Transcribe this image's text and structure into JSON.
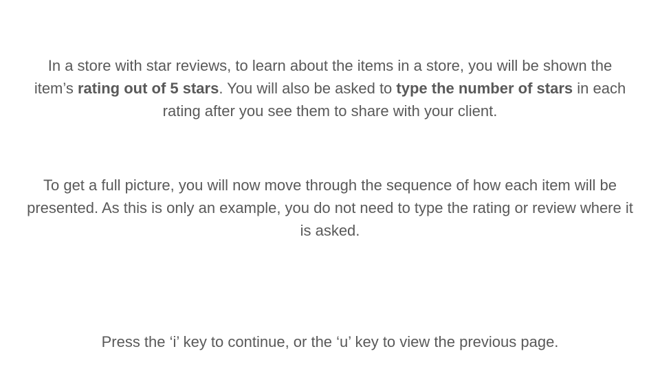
{
  "instructions": {
    "p1": {
      "t1": "In a store with star reviews, to learn about the items in a store, you will be shown the item’s ",
      "b1": "rating out of 5 stars",
      "t2": ". You will also be asked to ",
      "b2": "type the number of stars",
      "t3": " in each rating after you see them to share with your client."
    },
    "p2": "To get a full picture, you will now move through the sequence of how each item will be presented. As this is only an example, you do not need to type the rating or review where it is asked.",
    "p3": "Press the ‘i’ key to continue, or the ‘u’ key to view the previous page."
  }
}
